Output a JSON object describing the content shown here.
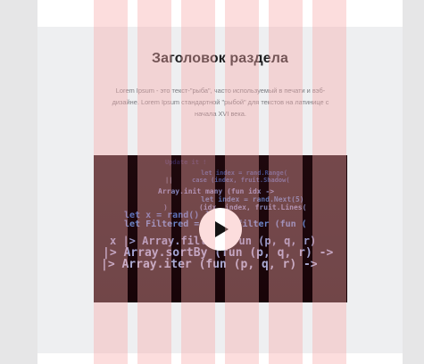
{
  "section": {
    "title": "Заголовок раздела",
    "text": "Lorem Ipsum - это текст-\"рыба\", часто используемый в печати и вэб-дизайне. Lorem Ipsum стандартной \"рыбой\" для текстов на латинице с начала XVI века."
  },
  "video": {
    "play_icon": "play-icon"
  },
  "code_lines": [
    "Update it !",
    "let index = rand.Range(",
    "case (index, fruit.Shadow(",
    "||",
    "Array.init many (fun idx ->",
    "let index = rand.Next(5)",
    "(idx, index, fruit.Lines(",
    ")",
    "let x = rand() ]",
    "let Filtered = Array.filter (fun (",
    "x |> Array.filter (fun (p, q, r)",
    "|> Array.sortBy (fun (p, q, r) ->",
    "|> Array.iter (fun (p, q, r) ->"
  ],
  "colors": {
    "background": "#e6e6e7",
    "section_bg": "#eeeff1",
    "grid_overlay": "#f8aaaa"
  }
}
